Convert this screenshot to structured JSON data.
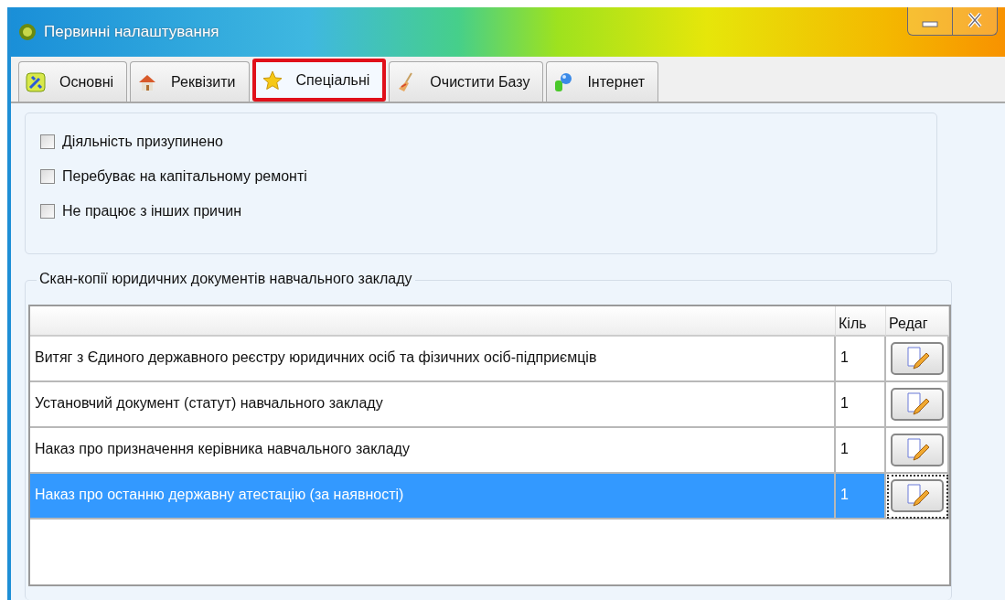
{
  "window": {
    "title": "Первинні налаштування"
  },
  "tabs": [
    {
      "label": "Основні",
      "selected": false
    },
    {
      "label": "Реквізити",
      "selected": false
    },
    {
      "label": "Спеціальні",
      "selected": true
    },
    {
      "label": "Очистити Базу",
      "selected": false
    },
    {
      "label": "Інтернет",
      "selected": false
    }
  ],
  "status_options": [
    {
      "label": "Діяльність призупинено",
      "checked": false
    },
    {
      "label": "Перебуває на капітальному ремонті",
      "checked": false
    },
    {
      "label": "Не працює з інших причин",
      "checked": false
    }
  ],
  "documents": {
    "title": "Скан-копії юридичних документів навчального закладу",
    "columns": [
      "Кіль",
      "Редаг"
    ],
    "rows": [
      {
        "name": "Витяг з Єдиного державного реєстру юридичних осіб та фізичних осіб-підприємців",
        "count": "1",
        "selected": false
      },
      {
        "name": "Установчий документ (статут) навчального закладу",
        "count": "1",
        "selected": false
      },
      {
        "name": "Наказ про призначення керівника навчального закладу",
        "count": "1",
        "selected": false
      },
      {
        "name": "Наказ про останню державну атестацію (за наявності)",
        "count": "1",
        "selected": true
      }
    ]
  }
}
